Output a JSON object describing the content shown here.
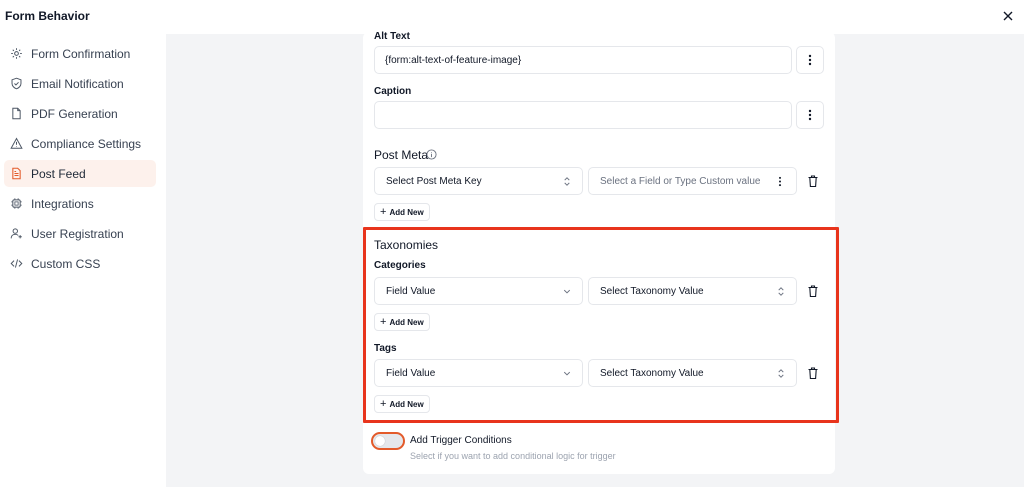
{
  "header": {
    "title": "Form Behavior"
  },
  "sidebar": {
    "items": [
      {
        "label": "Form Confirmation",
        "icon": "gear-icon"
      },
      {
        "label": "Email Notification",
        "icon": "shield-icon"
      },
      {
        "label": "PDF Generation",
        "icon": "file-icon"
      },
      {
        "label": "Compliance Settings",
        "icon": "warning-icon"
      },
      {
        "label": "Post Feed",
        "icon": "document-icon",
        "active": true
      },
      {
        "label": "Integrations",
        "icon": "chip-icon"
      },
      {
        "label": "User Registration",
        "icon": "user-plus-icon"
      },
      {
        "label": "Custom CSS",
        "icon": "code-icon"
      }
    ]
  },
  "content": {
    "alt_text": {
      "label": "Alt Text",
      "value": "{form:alt-text-of-feature-image}"
    },
    "caption": {
      "label": "Caption",
      "value": ""
    },
    "post_meta": {
      "title": "Post Meta",
      "key_placeholder": "Select Post Meta Key",
      "value_placeholder": "Select a Field or Type Custom value",
      "add_new": "Add New"
    },
    "taxonomies": {
      "title": "Taxonomies",
      "categories": {
        "label": "Categories",
        "source": "Field Value",
        "value_placeholder": "Select Taxonomy Value",
        "add_new": "Add New"
      },
      "tags": {
        "label": "Tags",
        "source": "Field Value",
        "value_placeholder": "Select Taxonomy Value",
        "add_new": "Add New"
      }
    },
    "trigger": {
      "label": "Add Trigger Conditions",
      "description": "Select if you want to add conditional logic for trigger",
      "enabled": false
    }
  },
  "colors": {
    "accent": "#e35a2a",
    "highlight": "#e8341c",
    "active_bg": "#fdf1ec"
  }
}
